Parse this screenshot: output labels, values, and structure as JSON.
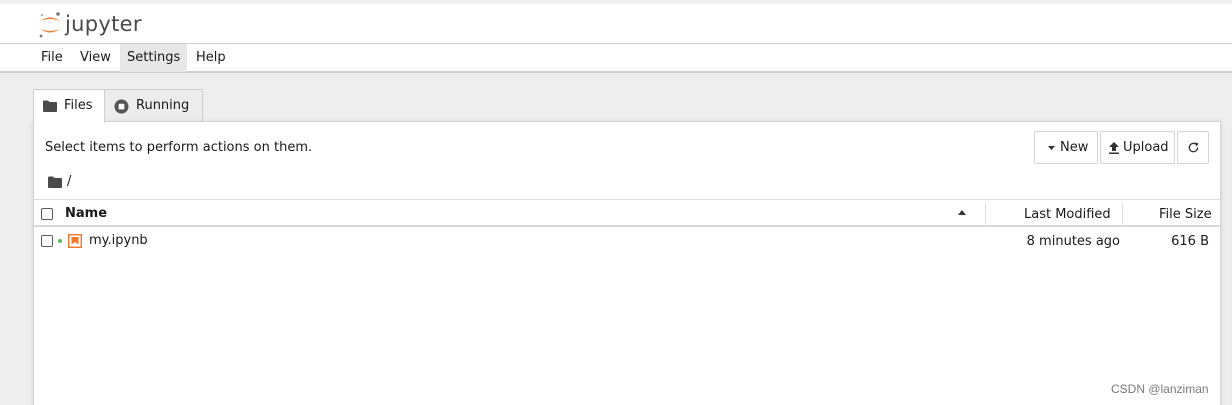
{
  "app": {
    "logo_text": "jupyter"
  },
  "menu": [
    {
      "label": "File"
    },
    {
      "label": "View"
    },
    {
      "label": "Settings"
    },
    {
      "label": "Help"
    }
  ],
  "tabs": [
    {
      "label": "Files",
      "icon": "folder-icon",
      "active": true
    },
    {
      "label": "Running",
      "icon": "stop-circle-icon",
      "active": false
    }
  ],
  "toolbar": {
    "instructions": "Select items to perform actions on them.",
    "new_label": "New",
    "upload_label": "Upload",
    "refresh_icon": "refresh-icon"
  },
  "breadcrumb": {
    "separator": "/"
  },
  "file_list": {
    "columns": {
      "name": "Name",
      "last_modified": "Last Modified",
      "file_size": "File Size"
    },
    "sort": "name-ascending",
    "rows": [
      {
        "name": "my.ipynb",
        "last_modified": "8 minutes ago",
        "file_size": "616 B",
        "running": true,
        "icon": "notebook-icon"
      }
    ]
  },
  "watermark": "CSDN @lanziman",
  "colors": {
    "jupyter_orange": "#f37726",
    "running_green": "#5cb85c"
  }
}
